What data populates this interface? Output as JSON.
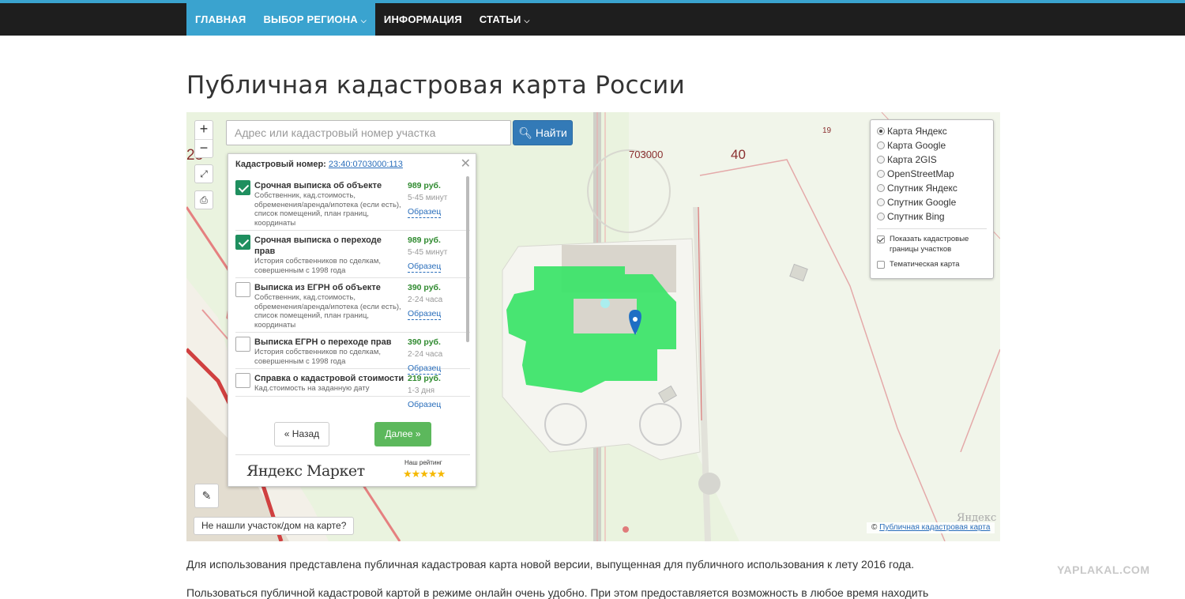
{
  "nav": {
    "items": [
      {
        "label": "ГЛАВНАЯ",
        "active": true,
        "dropdown": false
      },
      {
        "label": "ВЫБОР РЕГИОНА",
        "active": true,
        "dropdown": true
      },
      {
        "label": "ИНФОРМАЦИЯ",
        "active": false,
        "dropdown": false
      },
      {
        "label": "СТАТЬИ",
        "active": false,
        "dropdown": true
      }
    ],
    "accent_color": "#3aa3cf"
  },
  "page_title": "Публичная кадастровая карта России",
  "map": {
    "zoom_in": "+",
    "zoom_out": "−",
    "search_placeholder": "Адрес или кадастровый номер участка",
    "search_button": "Найти",
    "labels": {
      "block": "703000",
      "num40": "40",
      "num19": "19",
      "num23": "23"
    },
    "popup": {
      "cadastral_label": "Кадастровый номер:",
      "cadastral_number": "23:40:0703000:113",
      "services": [
        {
          "checked": true,
          "title": "Срочная выписка об объекте",
          "desc": "Собственник, кад.стоимость, обременения/аренда/ипотека (если есть), список помещений, план границ, координаты",
          "price": "989 руб.",
          "term": "5-45 минут",
          "sample": "Образец"
        },
        {
          "checked": true,
          "title": "Срочная выписка о переходе прав",
          "desc": "История собственников по сделкам, совершенным с 1998 года",
          "price": "989 руб.",
          "term": "5-45 минут",
          "sample": "Образец"
        },
        {
          "checked": false,
          "title": "Выписка из ЕГРН об объекте",
          "desc": "Собственник, кад.стоимость, обременения/аренда/ипотека (если есть), список помещений, план границ, координаты",
          "price": "390 руб.",
          "term": "2-24 часа",
          "sample": "Образец"
        },
        {
          "checked": false,
          "title": "Выписка ЕГРН о переходе прав",
          "desc": "История собственников по сделкам, совершенным с 1998 года",
          "price": "390 руб.",
          "term": "2-24 часа",
          "sample": "Образец"
        },
        {
          "checked": false,
          "title": "Справка о кадастровой стоимости",
          "desc": "Кад.стоимость на заданную дату",
          "price": "219 руб.",
          "term": "1-3 дня",
          "sample": "Образец"
        }
      ],
      "back_button": "« Назад",
      "next_button": "Далее »",
      "market_logo": "Яндекс Маркет",
      "rating_label": "Наш рейтинг",
      "rating_stars": "★★★★★"
    },
    "layers": {
      "options": [
        {
          "label": "Карта Яндекс",
          "selected": true
        },
        {
          "label": "Карта Google",
          "selected": false
        },
        {
          "label": "Карта 2GIS",
          "selected": false
        },
        {
          "label": "OpenStreetMap",
          "selected": false
        },
        {
          "label": "Спутник Яндекс",
          "selected": false
        },
        {
          "label": "Спутник Google",
          "selected": false
        },
        {
          "label": "Спутник Bing",
          "selected": false
        }
      ],
      "show_borders": {
        "label": "Показать кадастровые границы участков",
        "checked": true
      },
      "thematic": {
        "label": "Тематическая карта",
        "checked": false
      }
    },
    "not_found": "Не нашли участок/дом на карте?",
    "copyright_symbol": "©",
    "copyright_link": "Публичная кадастровая карта",
    "yandex_mark": "Яндекс",
    "parcel_color": "#3ee46a"
  },
  "paragraph1": "Для использования представлена публичная кадастровая карта новой версии, выпущенная для публичного использования к лету 2016 года.",
  "paragraph2": "Пользоваться публичной кадастровой картой в режиме онлайн очень удобно. При этом предоставляется возможность в любое время находить",
  "watermark": "YAPLAKAL.COM"
}
